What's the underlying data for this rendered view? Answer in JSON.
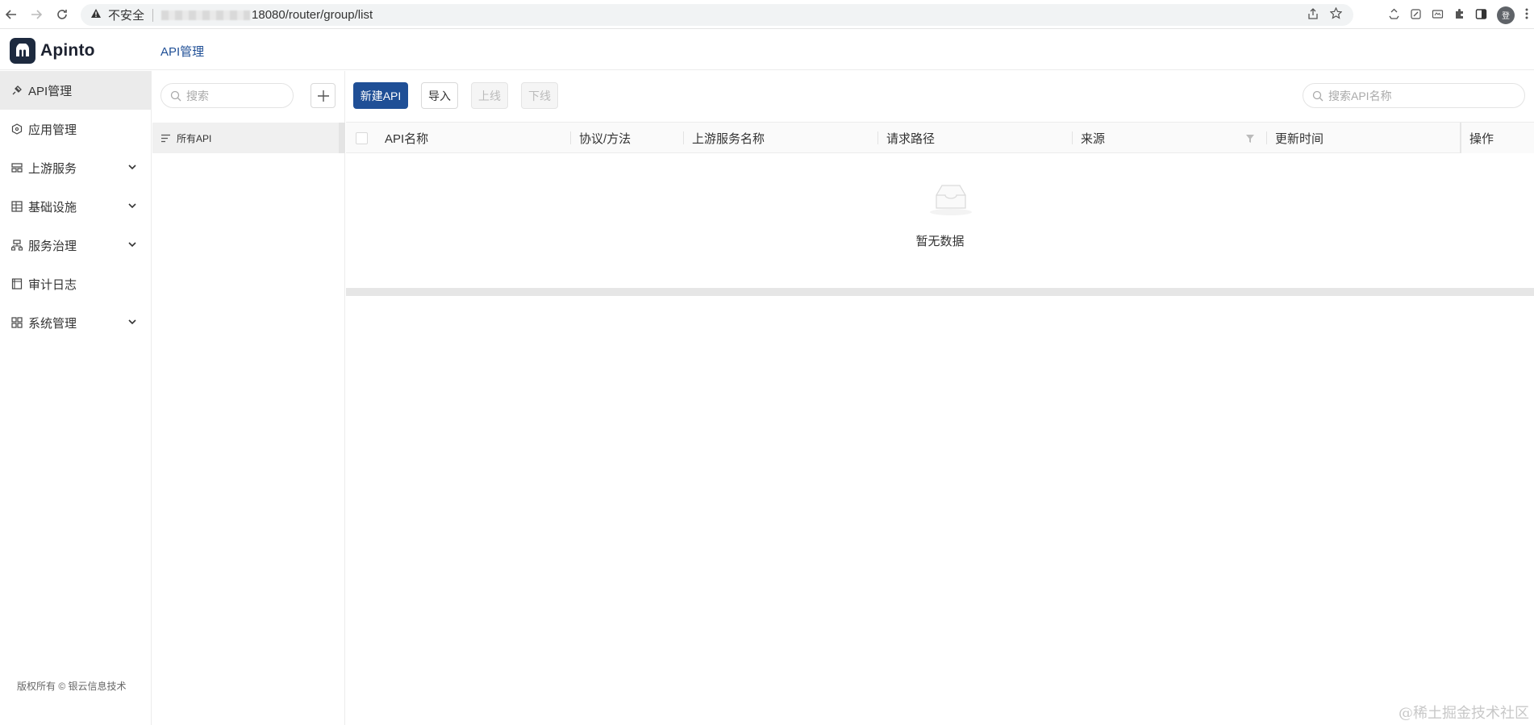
{
  "browser": {
    "insecure_label": "不安全",
    "url_path": "18080/router/group/list",
    "profile_initial": "登"
  },
  "header": {
    "logo_text": "Apinto",
    "breadcrumb": "API管理"
  },
  "sidebar": {
    "items": [
      {
        "label": "API管理",
        "icon": "api-icon",
        "active": true,
        "expandable": false
      },
      {
        "label": "应用管理",
        "icon": "app-icon",
        "active": false,
        "expandable": false
      },
      {
        "label": "上游服务",
        "icon": "upstream-icon",
        "active": false,
        "expandable": true
      },
      {
        "label": "基础设施",
        "icon": "infrastructure-icon",
        "active": false,
        "expandable": true
      },
      {
        "label": "服务治理",
        "icon": "governance-icon",
        "active": false,
        "expandable": true
      },
      {
        "label": "审计日志",
        "icon": "audit-log-icon",
        "active": false,
        "expandable": false
      },
      {
        "label": "系统管理",
        "icon": "system-icon",
        "active": false,
        "expandable": true
      }
    ],
    "copyright": "版权所有 © 银云信息技术"
  },
  "group_panel": {
    "search_placeholder": "搜索",
    "group_label": "所有API"
  },
  "toolbar": {
    "new_api": "新建API",
    "import": "导入",
    "online": "上线",
    "offline": "下线",
    "search_placeholder": "搜索API名称"
  },
  "table": {
    "columns": [
      "API名称",
      "协议/方法",
      "上游服务名称",
      "请求路径",
      "来源",
      "更新时间",
      "操作"
    ],
    "rows": [],
    "empty_text": "暂无数据"
  },
  "watermark": "@稀土掘金技术社区",
  "colors": {
    "primary": "#1f4f96",
    "logo_bg": "#1d2a3f",
    "active_menu_bg": "#ebebeb"
  }
}
